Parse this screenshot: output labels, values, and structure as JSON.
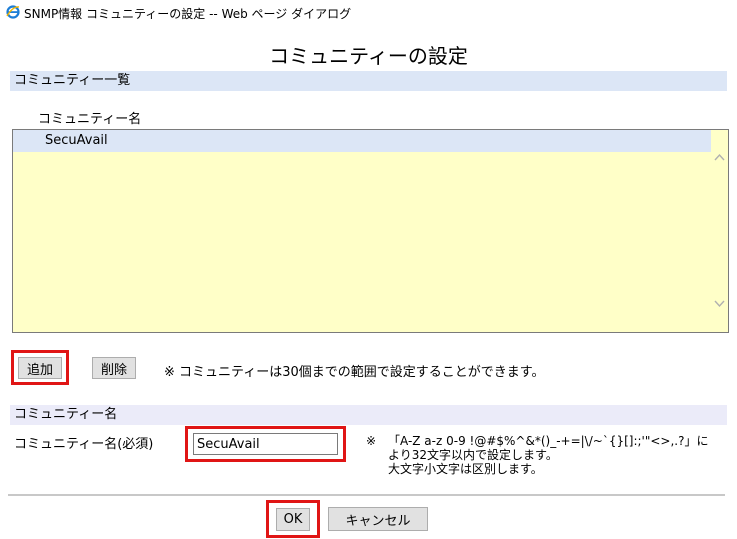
{
  "window": {
    "title": "SNMP情報 コミュニティーの設定 -- Web ページ ダイアログ",
    "icon": "ie-icon"
  },
  "page_title": "コミュニティーの設定",
  "community_list": {
    "section_title": "コミュニティー一覧",
    "column_label": "コミュニティー名",
    "items": [
      "SecuAvail"
    ],
    "selected": "SecuAvail"
  },
  "list_actions": {
    "add_label": "追加",
    "delete_label": "削除",
    "note": "※  コミュニティーは30個までの範囲で設定することができます。"
  },
  "edit_form": {
    "section_title": "コミュニティー名",
    "field_label": "コミュニティー名(必須)",
    "field_value": "SecuAvail",
    "note_mark": "※",
    "note_line1": "「A-Z a-z 0-9 !@#$%^&*()_-+=|\\/~`{}[]:;'\"<>,.?」に",
    "note_line2": "より32文字以内で設定します。",
    "note_line3": "大文字小文字は区別します。"
  },
  "footer": {
    "ok_label": "OK",
    "cancel_label": "キャンセル"
  },
  "colors": {
    "highlight_red": "#e01515",
    "list_background": "#ffffc8",
    "section_header": "#dce6f6"
  }
}
